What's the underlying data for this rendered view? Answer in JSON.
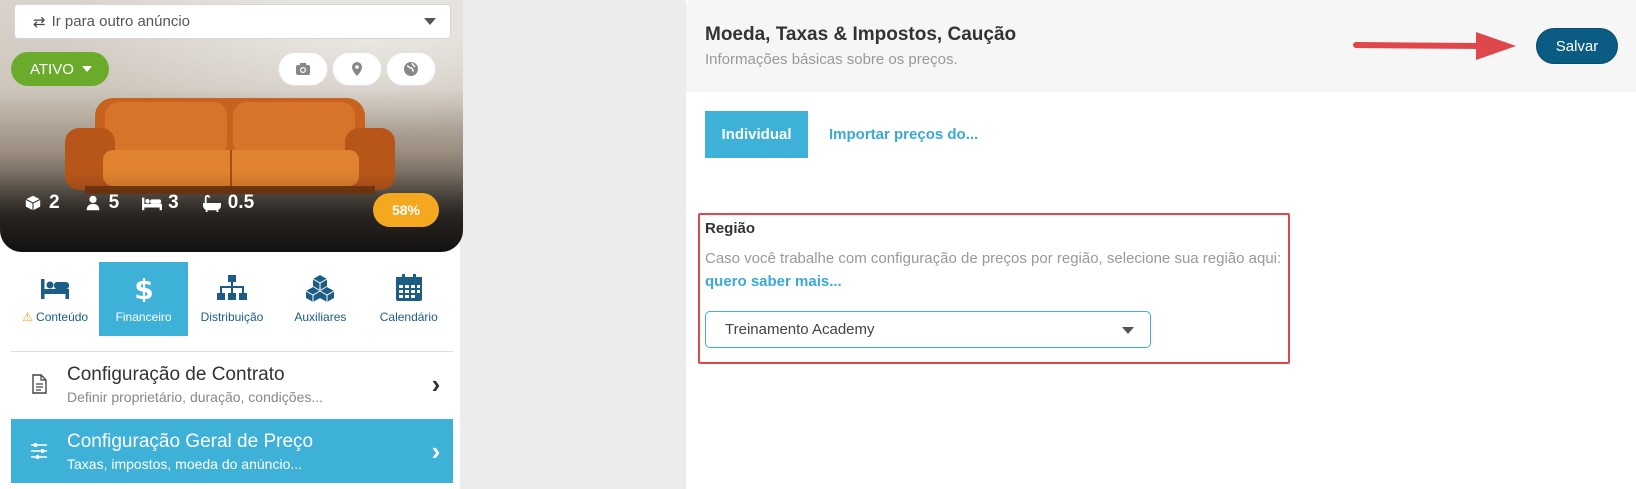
{
  "listing": {
    "goto_placeholder": "Ir para outro anúncio",
    "status": "ATIVO",
    "stats": {
      "boxes": "2",
      "guests": "5",
      "beds": "3",
      "baths": "0.5"
    },
    "completion": "58%"
  },
  "tabs": [
    {
      "label": "Conteúdo",
      "icon": "bed-icon",
      "warning": true
    },
    {
      "label": "Financeiro",
      "icon": "dollar-icon",
      "active": true
    },
    {
      "label": "Distribuição",
      "icon": "sitemap-icon"
    },
    {
      "label": "Auxiliares",
      "icon": "cubes-icon"
    },
    {
      "label": "Calendário",
      "icon": "calendar-icon"
    }
  ],
  "menu": [
    {
      "title": "Configuração de Contrato",
      "subtitle": "Definir proprietário, duração, condições..."
    },
    {
      "title": "Configuração Geral de Preço",
      "subtitle": "Taxas, impostos, moeda do anúncio...",
      "active": true
    }
  ],
  "header": {
    "title": "Moeda, Taxas & Impostos, Caução",
    "subtitle": "Informações básicas sobre os preços.",
    "save_label": "Salvar"
  },
  "mode": {
    "individual_label": "Individual",
    "import_label": "Importar preços do..."
  },
  "region": {
    "label": "Região",
    "description": "Caso você trabalhe com configuração de preços por região, selecione sua região aqui:",
    "link": "quero saber mais...",
    "selected": "Treinamento Academy"
  },
  "colors": {
    "accent": "#3eb1d9",
    "save": "#0b5c82",
    "status": "#6aab2b",
    "completion": "#f4a81f",
    "highlight_box": "#e0474a"
  }
}
